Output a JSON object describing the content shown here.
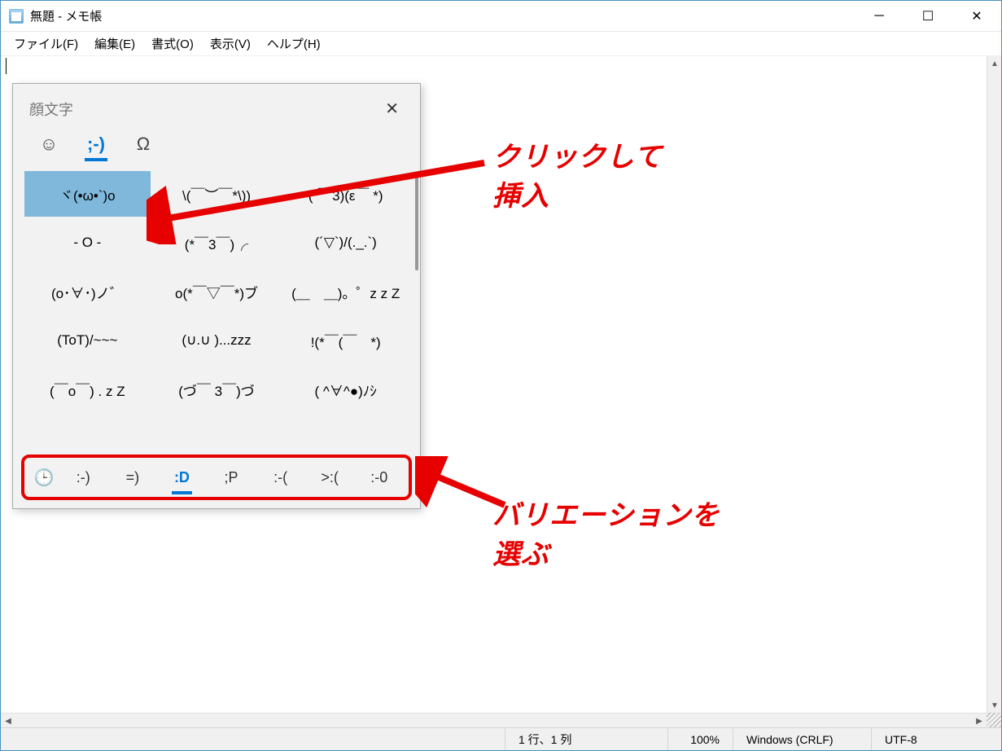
{
  "window": {
    "title": "無題 - メモ帳"
  },
  "menu": {
    "file": "ファイル(F)",
    "edit": "編集(E)",
    "format": "書式(O)",
    "view": "表示(V)",
    "help": "ヘルプ(H)"
  },
  "status": {
    "position": "1 行、1 列",
    "zoom": "100%",
    "line_ending": "Windows (CRLF)",
    "encoding": "UTF-8"
  },
  "panel": {
    "title": "顔文字",
    "tabs": {
      "emoji": "☺",
      "kaomoji": ";-)",
      "symbol": "Ω"
    },
    "kaomoji_grid": [
      "ヾ(•ω•`)o",
      "\\(￣︶￣*\\))",
      "(*￣3)(ε￣ *)",
      "- O -",
      "(*￣3￣)╭",
      "(´▽`)/(._.`)",
      "(o･∀･)ノ゛",
      "o(*￣▽￣*)ブ",
      "(＿　＿)。゜z z Z",
      "(ToT)/~~~",
      "(∪.∪ )...zzz",
      "!(*￣(￣　*)",
      "(￣o￣) . z Z",
      "(づ￣ 3￣)づ",
      "( ^∀^●)ﾉｼ"
    ],
    "variations": {
      "clock": "🕒",
      "items": [
        ":-)",
        "=)",
        ":D",
        ";P",
        ":-(",
        ">:(",
        ":-0"
      ],
      "active": ":D"
    }
  },
  "annotations": {
    "click_insert_l1": "クリックして",
    "click_insert_l2": "挿入",
    "variation_l1": "バリエーションを",
    "variation_l2": "選ぶ"
  }
}
